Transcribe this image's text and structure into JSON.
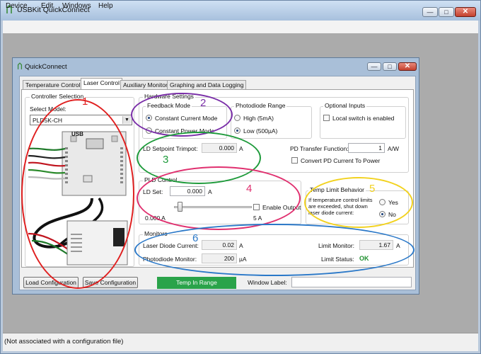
{
  "app": {
    "title": "USBKit QuickConnect",
    "window_buttons": {
      "minimize": "—",
      "maximize": "□",
      "close": "✕"
    },
    "menu": [
      "Device",
      "Edit",
      "Windows",
      "Help"
    ],
    "status": "(Not associated with a configuration file)"
  },
  "child": {
    "title": "QuickConnect",
    "tabs": [
      "Temperature Control",
      "Laser Control",
      "Auxiliary Monitor",
      "Graphing and Data Logging"
    ],
    "active_tab": "Laser Control"
  },
  "controller": {
    "group_label": "Controller Selection",
    "select_label": "Select Model:",
    "model_value": "PLD5K-CH",
    "board_usb_label": "USB"
  },
  "hardware": {
    "group_label": "Hardware Settings",
    "feedback": {
      "label": "Feedback Mode",
      "options": [
        "Constant Current Mode",
        "Constant Power Mode"
      ],
      "selected": "Constant Current Mode"
    },
    "photodiode_range": {
      "label": "Photodiode Range",
      "options": [
        "High (5mA)",
        "Low (500µA)"
      ],
      "selected": "Low (500µA)"
    },
    "optional_inputs": {
      "label": "Optional Inputs",
      "local_switch_label": "Local switch is enabled"
    },
    "ld_setpoint": {
      "label": "LD Setpoint Trimpot:",
      "value": "0.000",
      "unit": "A"
    },
    "pd_transfer": {
      "label": "PD Transfer Function:",
      "value": "1",
      "unit": "A/W"
    },
    "convert_label": "Convert PD Current To Power"
  },
  "pld": {
    "group_label": "PLD Control",
    "ld_set_label": "LD Set:",
    "ld_set_value": "0.000",
    "ld_set_unit": "A",
    "slider_min": "0.000 A",
    "slider_max": "5 A",
    "slider_level": 0.05,
    "enable_output_label": "Enable Output"
  },
  "temp_limit": {
    "group_label": "Temp Limit Behavior",
    "text": "If temperature control limits are exceeded, shut down laser diode current:",
    "options": [
      "Yes",
      "No"
    ],
    "selected": "No"
  },
  "monitors": {
    "group_label": "Monitors",
    "laser_diode_label": "Laser Diode Current:",
    "laser_diode_value": "0.02",
    "laser_diode_unit": "A",
    "photodiode_label": "Photodiode Monitor:",
    "photodiode_value": "200",
    "photodiode_unit": "µA",
    "limit_monitor_label": "Limit Monitor:",
    "limit_monitor_value": "1.67",
    "limit_monitor_unit": "A",
    "limit_status_label": "Limit Status:",
    "limit_status_value": "OK"
  },
  "bottom": {
    "load_label": "Load Configuration",
    "save_label": "Save Configuration",
    "temp_status": "Temp In Range",
    "window_label": "Window Label:"
  },
  "annotations": [
    "1",
    "2",
    "3",
    "4",
    "5",
    "6"
  ],
  "colors": {
    "red": "#e02020",
    "purple": "#7a2ea8",
    "green": "#1d9a3a",
    "pink": "#e0306f",
    "yellow": "#f2d21f",
    "blue": "#2a78c8",
    "temp_ok": "#2aa34a",
    "limit_ok": "#1e8f2e"
  }
}
